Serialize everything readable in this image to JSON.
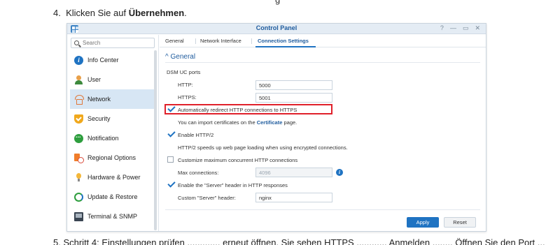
{
  "doc": {
    "top_fragment": "g",
    "step_number": "4.",
    "step_text": "Klicken Sie auf ",
    "step_bold": "Übernehmen",
    "step_end": ".",
    "bottom_fragment": "5.  Schritt 4: Einstellungen prüfen ............. erneut öffnen. Sie sehen HTTPS ............ Anmelden ........ Öffnen Sie den Port ..."
  },
  "window": {
    "title": "Control Panel",
    "controls": [
      "?",
      "—",
      "▭",
      "✕"
    ]
  },
  "sidebar": {
    "search_placeholder": "Search",
    "items": [
      {
        "label": "Info Center",
        "icon": "info-icon"
      },
      {
        "label": "User",
        "icon": "user-icon"
      },
      {
        "label": "Network",
        "icon": "network-icon"
      },
      {
        "label": "Security",
        "icon": "security-shield-icon"
      },
      {
        "label": "Notification",
        "icon": "notification-chat-icon"
      },
      {
        "label": "Regional Options",
        "icon": "regional-clock-icon"
      },
      {
        "label": "Hardware & Power",
        "icon": "hardware-bulb-icon"
      },
      {
        "label": "Update & Restore",
        "icon": "update-refresh-icon"
      },
      {
        "label": "Terminal & SNMP",
        "icon": "terminal-icon"
      }
    ],
    "active_index": 2
  },
  "tabs": [
    "General",
    "Network Interface",
    "Connection Settings"
  ],
  "active_tab": 2,
  "section": {
    "title": "General",
    "group_label": "DSM UC ports",
    "http_label": "HTTP:",
    "http_value": "5000",
    "https_label": "HTTPS:",
    "https_value": "5001",
    "redirect_label": "Automatically redirect HTTP connections to HTTPS",
    "redirect_checked": true,
    "cert_text_pre": "You can import certificates on the ",
    "cert_link": "Certificate",
    "cert_text_post": " page.",
    "http2_label": "Enable HTTP/2",
    "http2_checked": true,
    "http2_desc": "HTTP/2 speeds up web page loading when using encrypted connections.",
    "max_conn_check_label": "Customize maximum concurrent HTTP connections",
    "max_conn_checked": false,
    "max_conn_label": "Max connections:",
    "max_conn_value": "4096",
    "server_header_label": "Enable the \"Server\" header in HTTP responses",
    "server_header_checked": true,
    "custom_header_label": "Custom \"Server\" header:",
    "custom_header_value": "nginx"
  },
  "buttons": {
    "apply": "Apply",
    "reset": "Reset"
  },
  "colors": {
    "accent": "#1f73c2",
    "highlight_box": "#e0202a",
    "active_nav": "#d7e6f4"
  }
}
